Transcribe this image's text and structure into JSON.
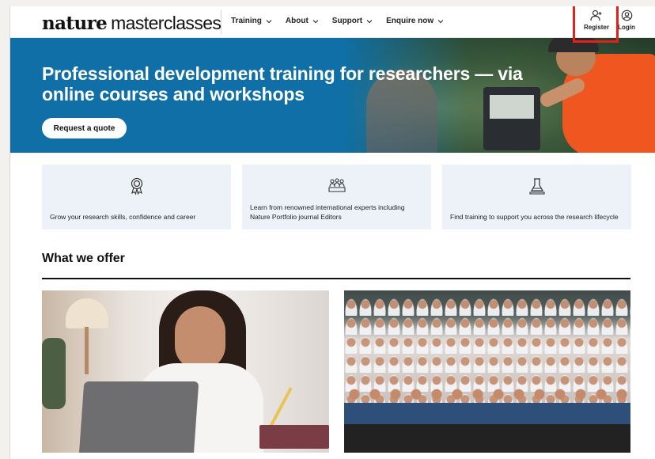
{
  "header": {
    "logo_bold": "nature",
    "logo_light": "masterclasses",
    "nav": [
      {
        "label": "Training"
      },
      {
        "label": "About"
      },
      {
        "label": "Support"
      },
      {
        "label": "Enquire now"
      }
    ],
    "register_label": "Register",
    "login_label": "Login"
  },
  "hero": {
    "title": "Professional development training for researchers — via online courses and workshops",
    "cta_label": "Request a quote"
  },
  "features": [
    {
      "icon": "award-rosette-icon",
      "text": "Grow your research skills, confidence and career"
    },
    {
      "icon": "group-people-icon",
      "text": "Learn from renowned international experts including Nature Portfolio journal Editors"
    },
    {
      "icon": "microscope-lab-icon",
      "text": "Find training to support you across the research lifecycle"
    }
  ],
  "offer": {
    "title": "What we offer"
  },
  "colors": {
    "hero_blue": "#0f6fa6",
    "card_bg": "#ecf2f8",
    "highlight_red": "#e32119"
  }
}
